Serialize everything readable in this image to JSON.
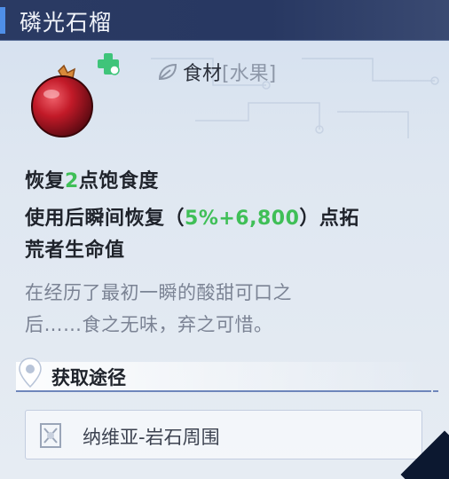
{
  "header": {
    "title": "磷光石榴"
  },
  "item": {
    "icon": "pomegranate-icon",
    "badge_icon": "heal-plus-icon",
    "type_icon": "leaf-icon",
    "type_main": "食材",
    "type_sub": "[水果]"
  },
  "effects": {
    "line1_pre": "恢复",
    "line1_value": "2",
    "line1_post": "点饱食度",
    "line2_pre": "使用后瞬间恢复（",
    "line2_value": "5%+6,800",
    "line2_post": "）点拓",
    "line3": "荒者生命值"
  },
  "description": {
    "line1": "在经历了最初一瞬的酸甜可口之",
    "line2": "后……食之无味，弃之可惜。"
  },
  "obtain": {
    "icon": "location-pin-icon",
    "label": "获取途径",
    "sources": [
      {
        "icon": "map-region-icon",
        "label": "纳维亚-岩石周围"
      }
    ]
  },
  "colors": {
    "header_bg": "#283862",
    "accent": "#4f8fe8",
    "highlight_green": "#3fbf57",
    "panel_bg": "#dfe7f1"
  }
}
